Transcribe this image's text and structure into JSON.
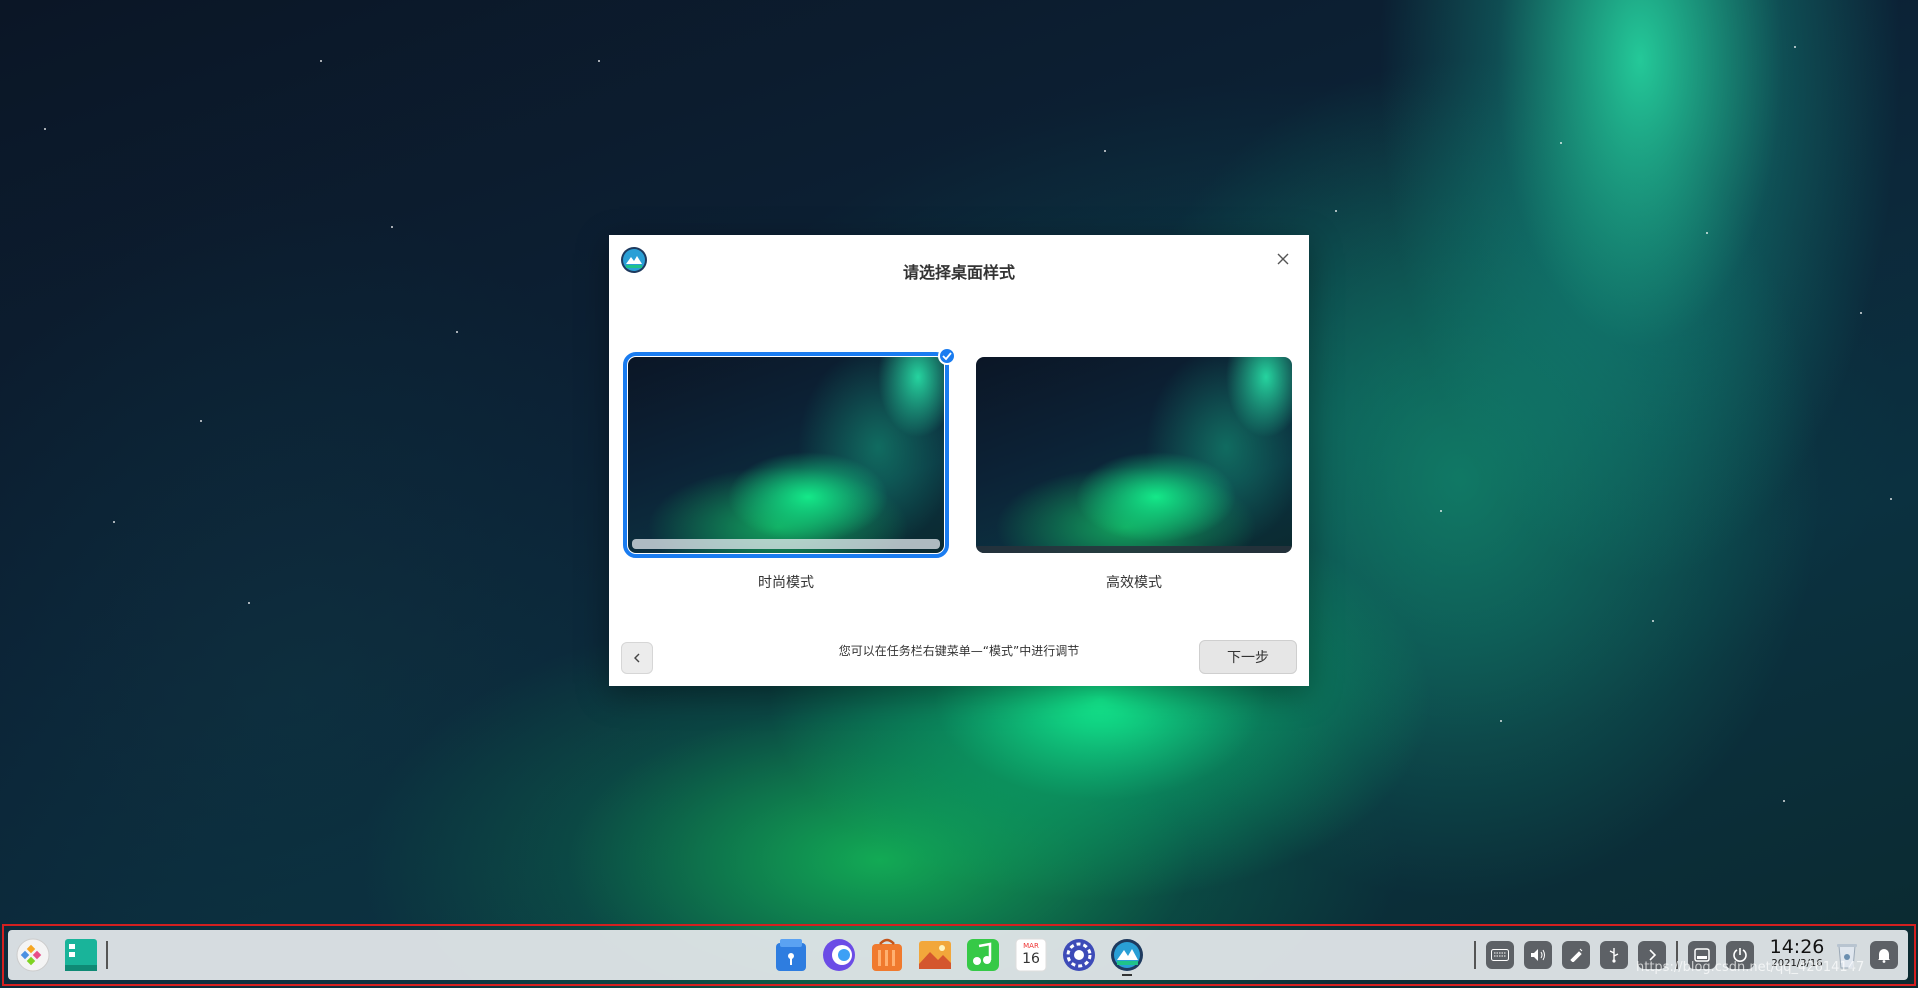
{
  "dialog": {
    "title": "请选择桌面样式",
    "modes": [
      {
        "label": "时尚模式",
        "selected": true
      },
      {
        "label": "高效模式",
        "selected": false
      }
    ],
    "hint": "您可以在任务栏右键菜单—“模式”中进行调节",
    "next_label": "下一步",
    "accent_color": "#1a7cf0"
  },
  "taskbar": {
    "left_items": [
      "launcher-icon",
      "multitask-view-icon"
    ],
    "center_apps": [
      "file-manager-icon",
      "browser-icon",
      "app-store-icon",
      "image-viewer-icon",
      "music-icon",
      "calendar-icon",
      "control-center-icon",
      "welcome-app-icon"
    ],
    "calendar_month": "MAR",
    "calendar_day": "16",
    "tray_items": [
      "keyboard-icon",
      "volume-icon",
      "pen-icon",
      "usb-icon",
      "expand-chevron-icon",
      "screen-icon",
      "power-icon"
    ],
    "clock": {
      "time": "14:26",
      "date": "2021/3/16"
    },
    "right_items": [
      "trash-icon",
      "notification-bell-icon"
    ]
  },
  "watermark": "https://blog.csdn.net/qq_42614147"
}
